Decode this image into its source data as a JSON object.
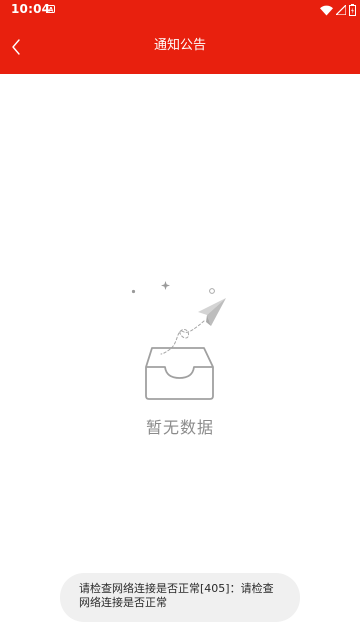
{
  "status_bar": {
    "time": "10:04",
    "icons": [
      "notification-a-icon",
      "wifi-icon",
      "cell-signal-icon",
      "battery-icon"
    ]
  },
  "app_bar": {
    "title": "通知公告",
    "back_icon": "chevron-left-icon"
  },
  "empty_state": {
    "illustration": "empty-inbox-paper-plane-illustration",
    "text": "暂无数据"
  },
  "toast": {
    "message": "请检查网络连接是否正常[405]：请检查网络连接是否正常"
  },
  "colors": {
    "primary": "#e8200e",
    "empty_text": "#8c8c8c",
    "toast_bg": "#f0f0f0"
  }
}
